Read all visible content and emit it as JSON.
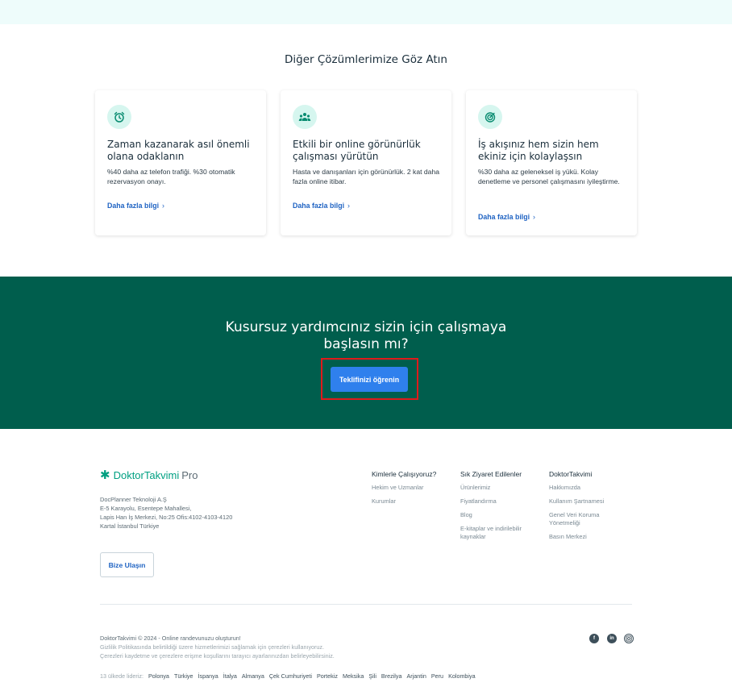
{
  "section": {
    "title": "Diğer Çözümlerimize Göz Atın"
  },
  "cards": [
    {
      "icon": "alarm-clock-icon",
      "title": "Zaman kazanarak asıl önemli olana odaklanın",
      "text": "%40 daha az telefon trafiği. %30 otomatik rezervasyon onayı.",
      "link": "Daha fazla bilgi"
    },
    {
      "icon": "people-group-icon",
      "title": "Etkili bir online görünürlük çalışması yürütün",
      "text": "Hasta ve danışanları için görünürlük. 2 kat daha fazla online itibar.",
      "link": "Daha fazla bilgi"
    },
    {
      "icon": "target-icon",
      "title": "İş akışınız hem sizin hem ekiniz için kolaylaşsın",
      "text": "%30 daha az geleneksel iş yükü. Kolay denetleme ve personel çalışmasını iyileştirme.",
      "link": "Daha fazla bilgi"
    }
  ],
  "cta": {
    "title_line1": "Kusursuz yardımcınız sizin için çalışmaya",
    "title_line2": "başlasın mı?",
    "button": "Teklifinizi öğrenin"
  },
  "footer": {
    "logo_brand": "DoktorTakvimi",
    "logo_suffix": "Pro",
    "address": [
      "DocPlanner Teknoloji A.Ş",
      "E-5 Karayolu, Esentepe Mahallesi,",
      "Lapis Han İş Merkezi, No:25 Ofis:4102-4103-4120",
      "Kartal İstanbul Türkiye"
    ],
    "contact_button": "Bize Ulaşın",
    "columns": [
      {
        "head": "Kimlerle Çalışıyoruz?",
        "links": [
          "Hekim ve Uzmanlar",
          "Kurumlar"
        ]
      },
      {
        "head": "Sık Ziyaret Edilenler",
        "links": [
          "Ürünlerimiz",
          "Fiyatlandırma",
          "Blog",
          "E-kitaplar ve indirilebilir kaynaklar"
        ]
      },
      {
        "head": "DoktorTakvimi",
        "links": [
          "Hakkımızda",
          "Kullanım Şartnamesi",
          "Genel Veri Koruma Yönetmeliği",
          "Basın Merkezi"
        ]
      }
    ],
    "copyright": "DoktorTakvimi © 2024 - Online randevunuzu oluşturun!",
    "privacy_line1": "Gizlilik Politikasında belirtildiği üzere hizmetlerimizi sağlamak için çerezleri kullanıyoruz.",
    "privacy_line2": "Çerezleri kaydetme ve çerezlere erişme koşullarını tarayıcı ayarlarınızdan belirleyebilirsiniz.",
    "social": [
      "facebook-icon",
      "linkedin-icon",
      "instagram-icon"
    ],
    "countries_label": "13 ülkede lideriz:",
    "countries": [
      "Polonya",
      "Türkiye",
      "İspanya",
      "İtalya",
      "Almanya",
      "Çek Cumhuriyeti",
      "Portekiz",
      "Meksika",
      "Şili",
      "Brezilya",
      "Arjantin",
      "Peru",
      "Kolombiya"
    ]
  },
  "colors": {
    "cta_bg": "#005e4d",
    "brand": "#00a082",
    "button": "#2f80ed",
    "link": "#1f63c3",
    "highlight": "#e01b1b"
  }
}
